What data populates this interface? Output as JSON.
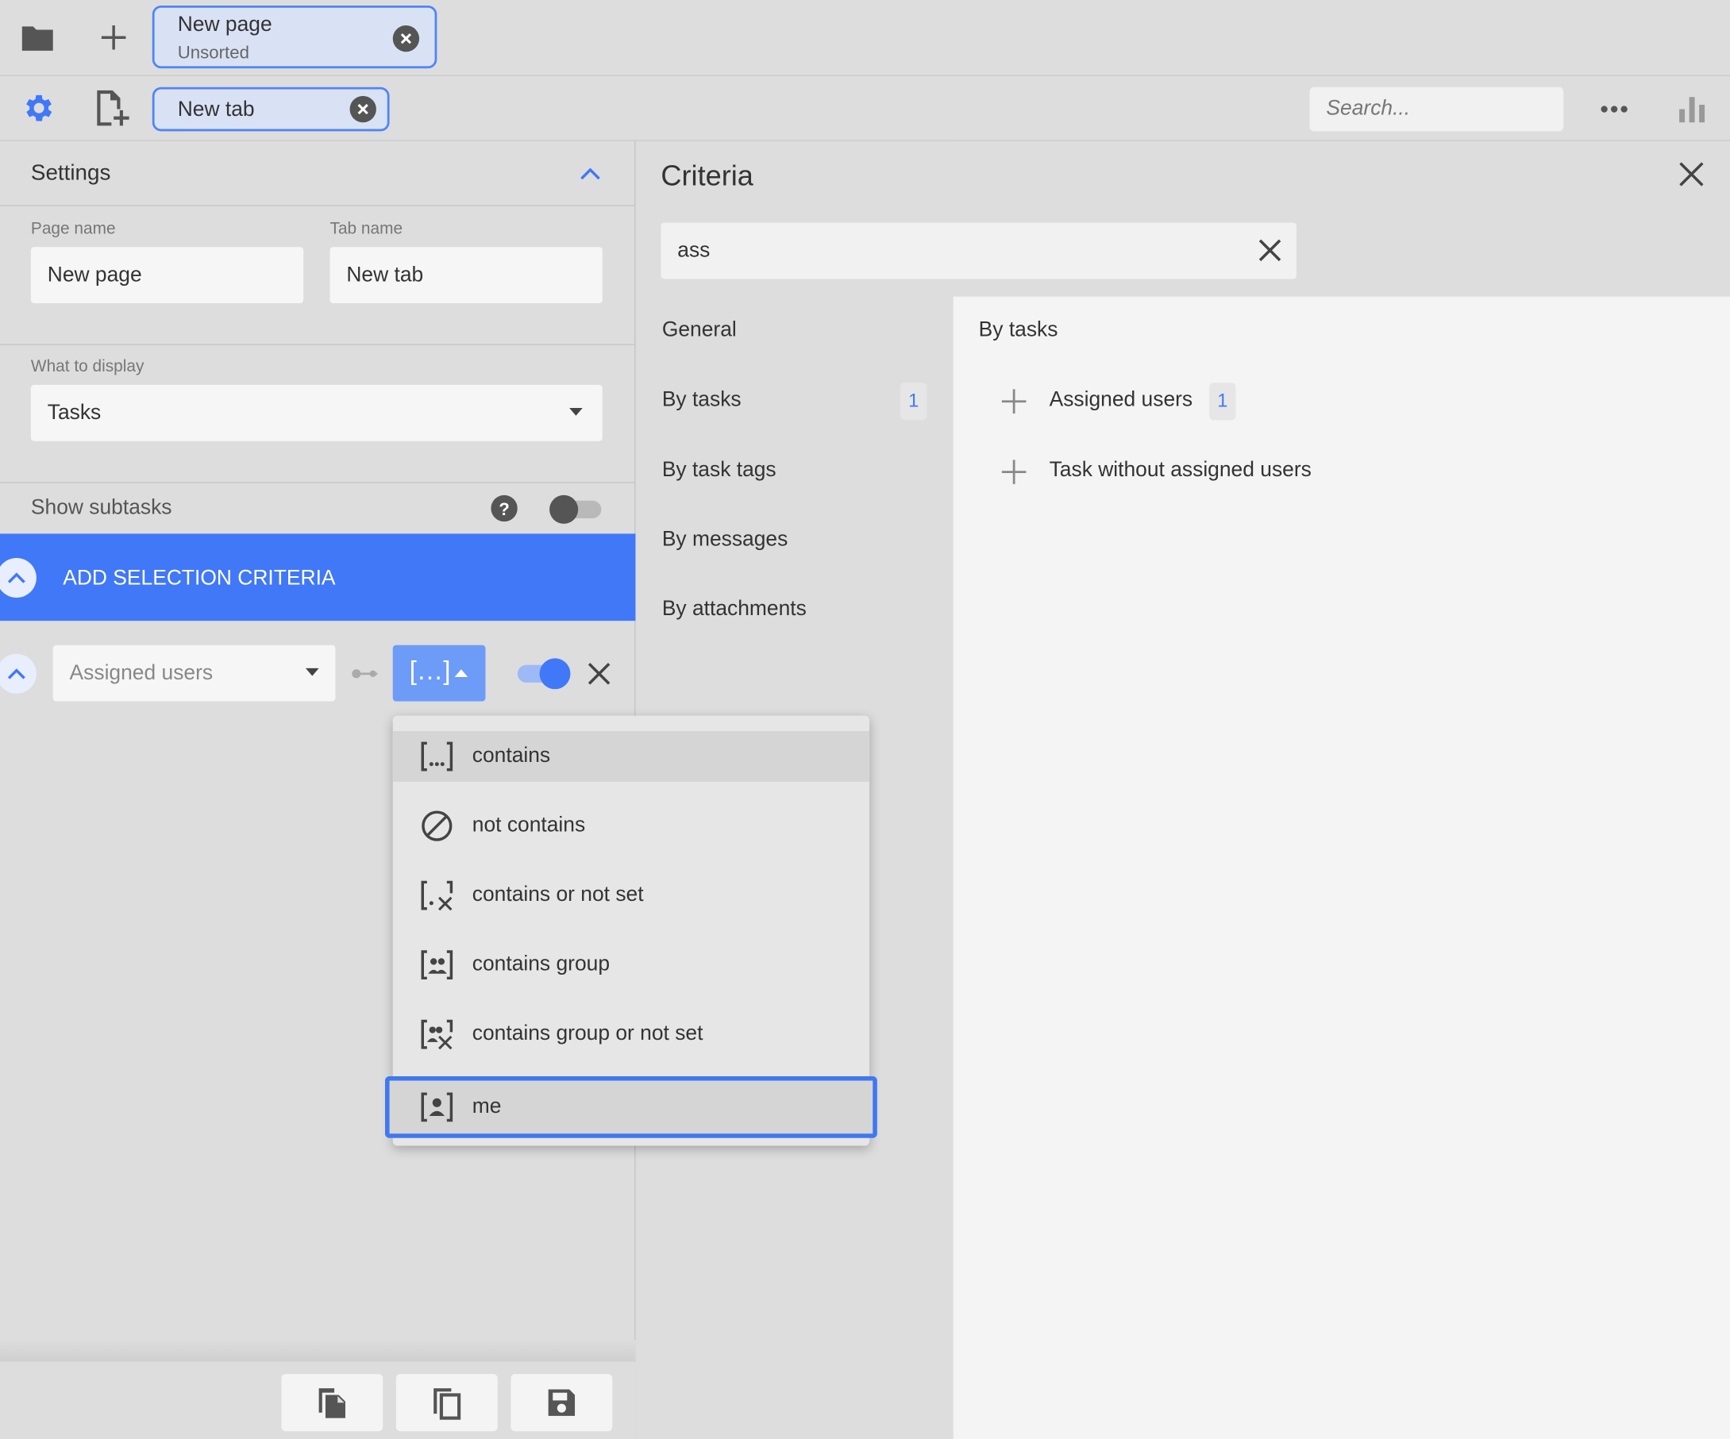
{
  "top_tab": {
    "title": "New page",
    "subtitle": "Unsorted"
  },
  "sub_tab": {
    "title": "New tab"
  },
  "search": {
    "placeholder": "Search..."
  },
  "settings": {
    "title": "Settings",
    "page_name_label": "Page name",
    "page_name_value": "New page",
    "tab_name_label": "Tab name",
    "tab_name_value": "New tab",
    "display_label": "What to display",
    "display_value": "Tasks",
    "show_subtasks_label": "Show subtasks",
    "add_criteria_label": "ADD SELECTION CRITERIA",
    "criteria_field_placeholder": "Assigned users",
    "operator_symbol": "[...]"
  },
  "operator_menu": {
    "items": [
      {
        "label": "contains",
        "icon": "brackets-ellipsis-icon"
      },
      {
        "label": "not contains",
        "icon": "prohibited-icon"
      },
      {
        "label": "contains or not set",
        "icon": "bracket-x-icon"
      },
      {
        "label": "contains group",
        "icon": "group-bracket-icon"
      },
      {
        "label": "contains group or not set",
        "icon": "group-bracket-x-icon"
      },
      {
        "label": "me",
        "icon": "person-bracket-icon"
      }
    ]
  },
  "criteria": {
    "title": "Criteria",
    "search_value": "ass",
    "categories": [
      {
        "label": "General"
      },
      {
        "label": "By tasks",
        "badge": "1"
      },
      {
        "label": "By task tags"
      },
      {
        "label": "By messages"
      },
      {
        "label": "By attachments"
      }
    ],
    "section_title": "By tasks",
    "options": [
      {
        "label": "Assigned users",
        "badge": "1"
      },
      {
        "label": "Task without assigned users"
      }
    ]
  },
  "colors": {
    "accent": "#4178f7",
    "background": "#dddddd",
    "panel": "#f4f4f4"
  }
}
